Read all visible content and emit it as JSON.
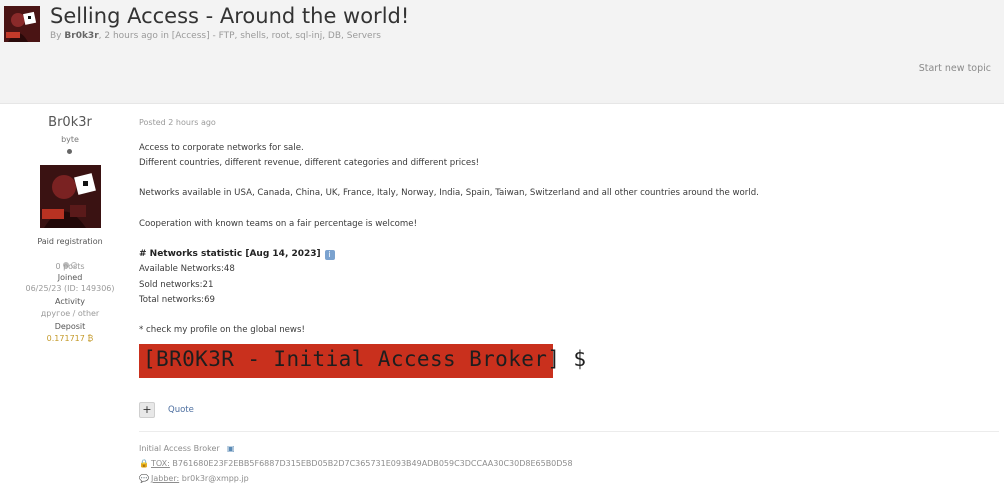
{
  "thread": {
    "title": "Selling Access - Around the world!",
    "by_label": "By",
    "author": "Br0k3r",
    "meta_rest": ", 2 hours ago in [Access] - FTP, shells, root, sql-inj, DB, Servers",
    "start_new_topic": "Start new topic"
  },
  "author_panel": {
    "name": "Br0k3r",
    "rank": "byte",
    "group": "Paid registration",
    "posts": "0 posts",
    "joined_label": "Joined",
    "joined_value": "06/25/23 (ID: 149306)",
    "activity_label": "Activity",
    "activity_value": "другое / other",
    "deposit_label": "Deposit",
    "deposit_value": "0.171717 ₿"
  },
  "post": {
    "posted": "Posted 2 hours ago",
    "line1": "Access to corporate networks for sale.",
    "line2": "Different countries, different revenue, different categories and different prices!",
    "line3": "Networks available in USA, Canada, China, UK, France, Italy, Norway, India, Spain, Taiwan, Switzerland and all other countries around the world.",
    "line4": "Cooperation with known teams on a fair percentage is welcome!",
    "stats_title": "# Networks statistic [Aug 14, 2023]",
    "available": "Available Networks:48",
    "sold": "Sold networks:21",
    "total": "Total networks:69",
    "check_profile": "* check my profile on the global news!",
    "banner": "[BR0K3R - Initial Access Broker] $",
    "quote_label": "Quote",
    "plus_label": "+"
  },
  "signature": {
    "title": "Initial Access Broker",
    "tox_label": "TOX:",
    "tox_value": "B761680E23F2EBB5F6887D315EBD05B2D7C365731E093B49ADB059C3DCCAA30C30D8E65B0D58",
    "jabber_label": "Jabber:",
    "jabber_value": "br0k3r@xmpp.jp"
  },
  "colors": {
    "banner_bg": "#c9301d",
    "deposit": "#c49a2a",
    "link": "#4d6fa0"
  }
}
